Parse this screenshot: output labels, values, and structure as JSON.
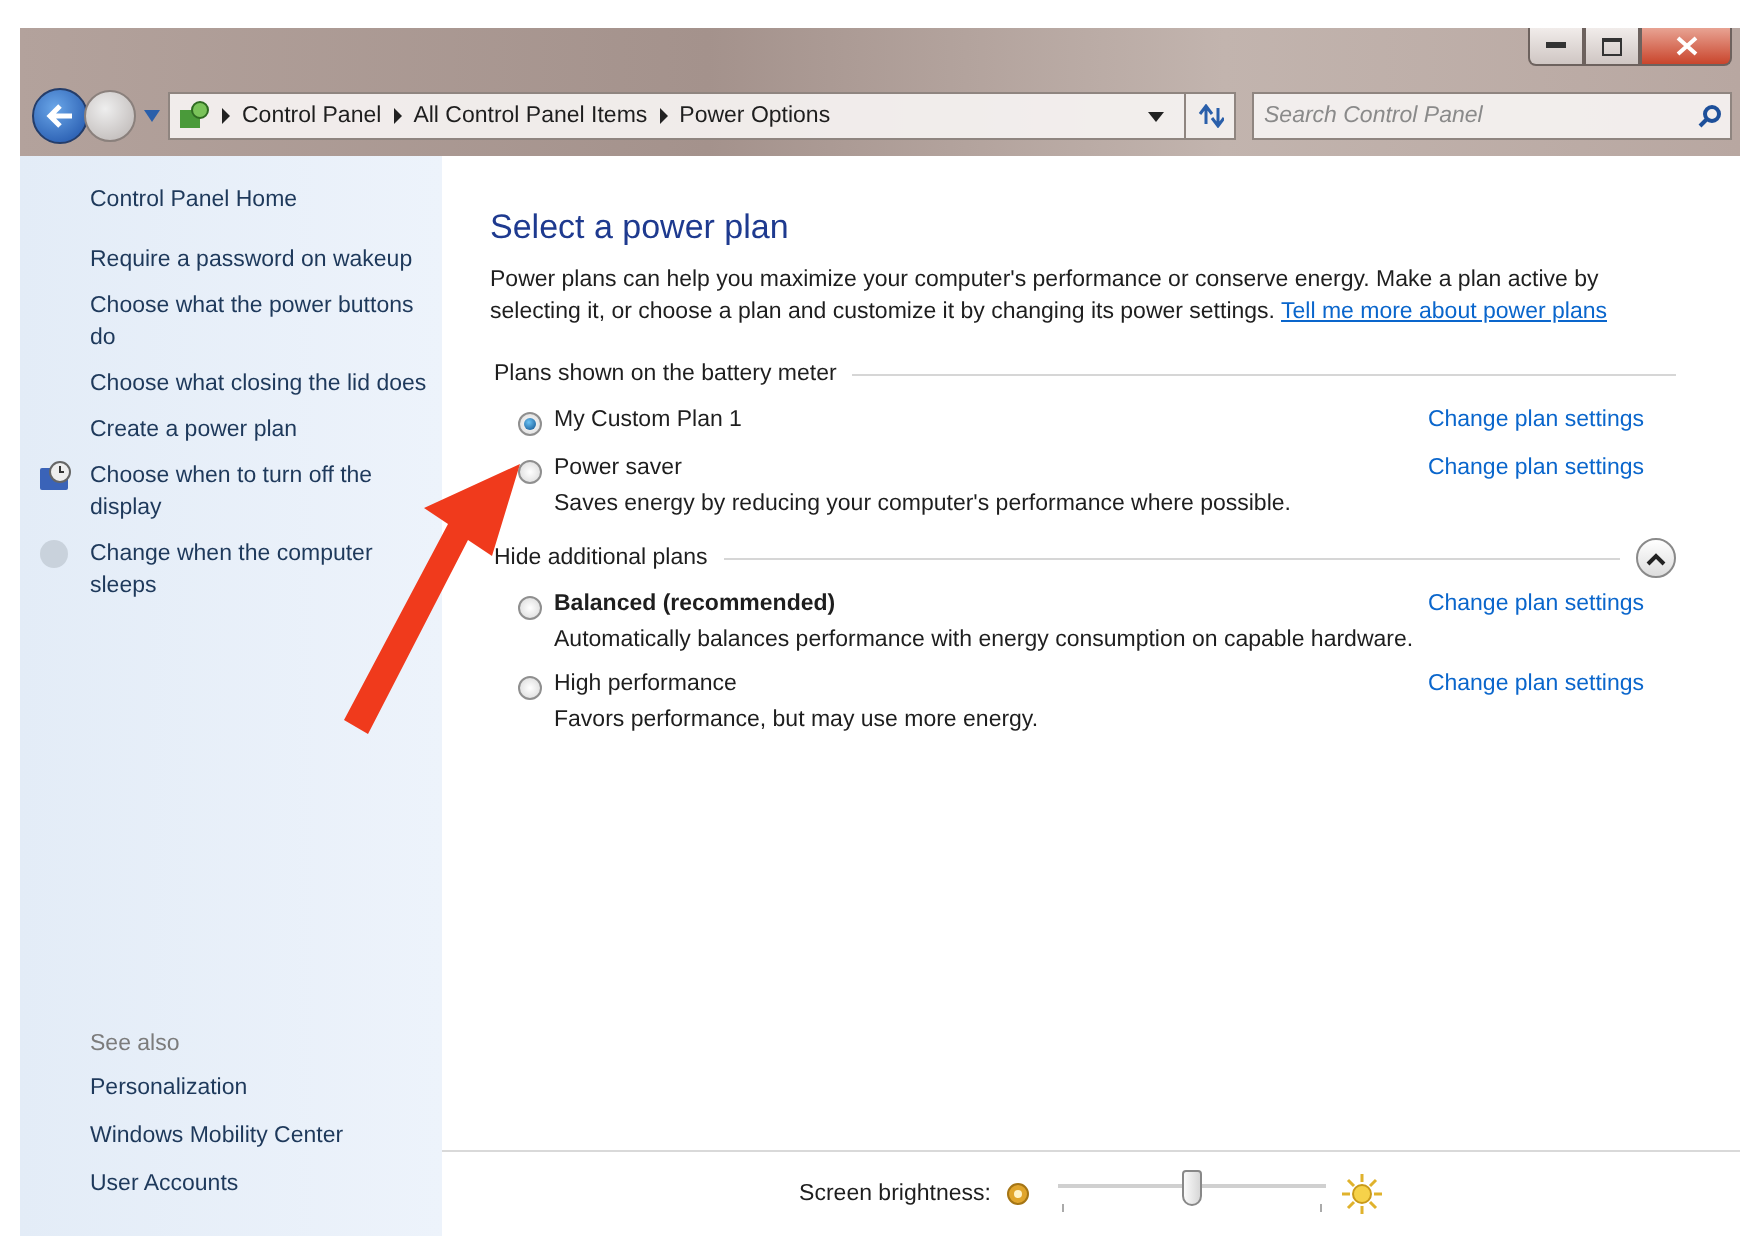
{
  "address_bar": {
    "crumbs": [
      "Control Panel",
      "All Control Panel Items",
      "Power Options"
    ]
  },
  "search": {
    "placeholder": "Search Control Panel"
  },
  "sidebar": {
    "home": "Control Panel Home",
    "items": [
      {
        "label": "Require a password on wakeup",
        "kind": "link"
      },
      {
        "label": "Choose what the power buttons do",
        "kind": "link"
      },
      {
        "label": "Choose what closing the lid does",
        "kind": "link"
      },
      {
        "label": "Create a power plan",
        "kind": "link"
      },
      {
        "label": "Choose when to turn off the display",
        "kind": "iconlink"
      },
      {
        "label": "Change when the computer sleeps",
        "kind": "iconlink"
      }
    ],
    "see_also": {
      "title": "See also",
      "items": [
        "Personalization",
        "Windows Mobility Center",
        "User Accounts"
      ]
    }
  },
  "main": {
    "title": "Select a power plan",
    "intro": "Power plans can help you maximize your computer's performance or conserve energy. Make a plan active by selecting it, or choose a plan and customize it by changing its power settings.",
    "intro_link": "Tell me more about power plans",
    "sections": [
      {
        "title": "Plans shown on the battery meter",
        "plans": [
          {
            "name": "My Custom Plan 1",
            "selected": true,
            "emphasized": false,
            "link": "Change plan settings"
          },
          {
            "name": "Power saver",
            "selected": false,
            "emphasized": false,
            "description": "Saves energy by reducing your computer's performance where possible.",
            "link": "Change plan settings"
          }
        ]
      },
      {
        "title": "Hide additional plans",
        "expanded": true,
        "plans": [
          {
            "name": "Balanced (recommended)",
            "selected": false,
            "emphasized": true,
            "description": "Automatically balances performance with energy consumption on capable hardware.",
            "link": "Change plan settings"
          },
          {
            "name": "High performance",
            "selected": false,
            "emphasized": false,
            "description": "Favors performance, but may use more energy.",
            "link": "Change plan settings"
          }
        ]
      }
    ]
  },
  "brightness": {
    "label": "Screen brightness:",
    "level": 0.5
  }
}
